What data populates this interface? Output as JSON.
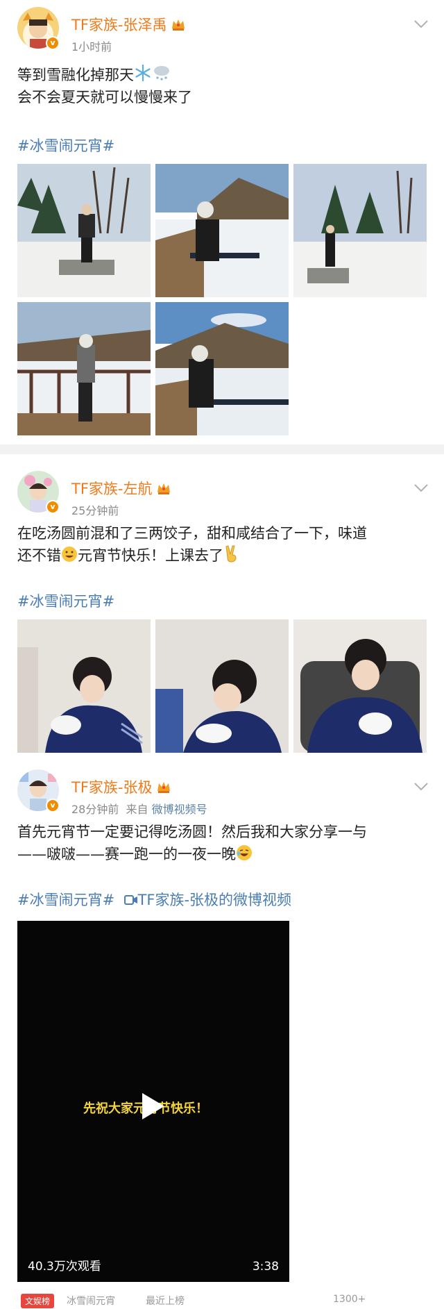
{
  "posts": [
    {
      "name": "TF家族-张泽禹",
      "time": "1小时前",
      "lines": [
        "等到雪融化掉那天",
        "会不会夏天就可以慢慢来了"
      ],
      "emojis": [
        "snowflake-emoji",
        "snow-cloud-emoji"
      ],
      "hashtag": "#冰雪闹元宵#"
    },
    {
      "name": "TF家族-左航",
      "time": "25分钟前",
      "lines": [
        "在吃汤圆前混和了三两饺子，甜和咸结合了一下，味道",
        "还不错",
        "元宵节快乐！上课去了"
      ],
      "hashtag": "#冰雪闹元宵#"
    },
    {
      "name": "TF家族-张极",
      "time": "28分钟前",
      "source_prefix": "来自",
      "source": "微博视频号",
      "lines": [
        "首先元宵节一定要记得吃汤圆！然后我和大家分享一与",
        "——啵啵——赛一跑一的一夜一晚"
      ],
      "hashtag": "#冰雪闹元宵#",
      "video_link": "TF家族-张极的微博视频",
      "video": {
        "caption": "先祝大家元宵节快乐！",
        "views": "40.3万次观看",
        "duration": "3:38"
      },
      "bottom": {
        "tag": "文娱榜",
        "topic": "冰雪闹元宵",
        "recent": "最近上榜",
        "count": "1300+"
      }
    }
  ],
  "badge_letter": "v",
  "colors": {
    "name": "#f07a1a",
    "hashtag": "#4a7db3",
    "meta": "#8a8a8a",
    "badge": "#f08c00"
  }
}
